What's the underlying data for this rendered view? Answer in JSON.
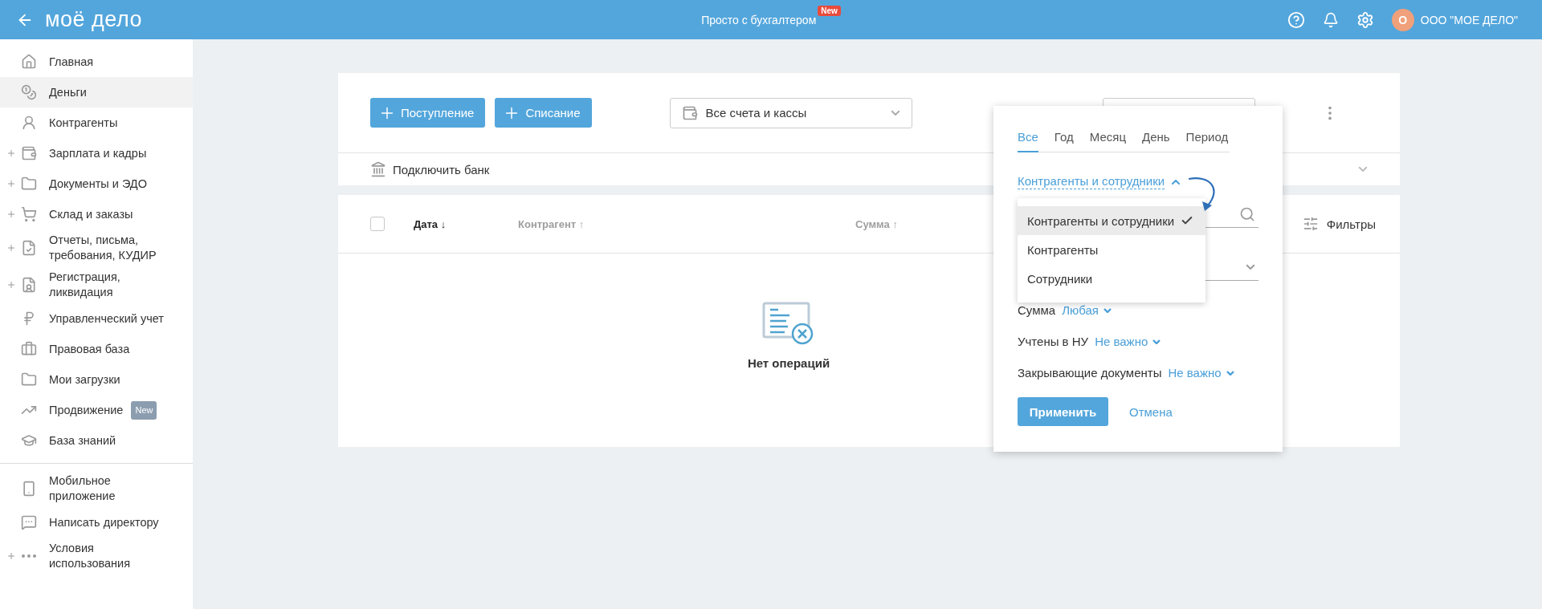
{
  "header": {
    "logo": "моё дело",
    "promo": "Просто с бухгалтером",
    "promo_badge": "New",
    "avatar_letter": "О",
    "company": "ООО \"МОЕ ДЕЛО\""
  },
  "sidebar": {
    "items": [
      {
        "label": "Главная",
        "selected": false,
        "expandable": false
      },
      {
        "label": "Деньги",
        "selected": true,
        "expandable": false
      },
      {
        "label": "Контрагенты",
        "selected": false,
        "expandable": false
      },
      {
        "label": "Зарплата и кадры",
        "selected": false,
        "expandable": true
      },
      {
        "label": "Документы и ЭДО",
        "selected": false,
        "expandable": true
      },
      {
        "label": "Склад и заказы",
        "selected": false,
        "expandable": true
      },
      {
        "label": "Отчеты, письма, требования, КУДИР",
        "selected": false,
        "expandable": true
      },
      {
        "label": "Регистрация, ликвидация",
        "selected": false,
        "expandable": true
      },
      {
        "label": "Управленческий учет",
        "selected": false,
        "expandable": false
      },
      {
        "label": "Правовая база",
        "selected": false,
        "expandable": false
      },
      {
        "label": "Мои загрузки",
        "selected": false,
        "expandable": false
      },
      {
        "label": "Продвижение",
        "selected": false,
        "expandable": false,
        "badge": "New"
      },
      {
        "label": "База знаний",
        "selected": false,
        "expandable": false
      }
    ],
    "bottom_items": [
      {
        "label": "Мобильное приложение",
        "selected": false,
        "expandable": false
      },
      {
        "label": "Написать директору",
        "selected": false,
        "expandable": false
      },
      {
        "label": "Условия использования",
        "selected": false,
        "expandable": true
      }
    ]
  },
  "toolbar": {
    "buttons": [
      "Поступление",
      "Списание"
    ],
    "account_select": "Все счета и кассы"
  },
  "bank": {
    "label": "Подключить банк"
  },
  "table": {
    "select_all": false,
    "columns": [
      {
        "label": "Дата",
        "arrow": "↓",
        "active": true
      },
      {
        "label": "Контрагент",
        "arrow": "↑",
        "active": false
      },
      {
        "label": "Сумма",
        "arrow": "↑",
        "active": false
      }
    ],
    "filters": "Фильтры",
    "empty": "Нет операций"
  },
  "filter_popup": {
    "tabs": [
      {
        "label": "Все",
        "selected": true
      },
      {
        "label": "Год",
        "selected": false
      },
      {
        "label": "Месяц",
        "selected": false
      },
      {
        "label": "День",
        "selected": false
      },
      {
        "label": "Период",
        "selected": false
      }
    ],
    "counterparty_link": "Контрагенты и сотрудники",
    "dropdown": [
      {
        "label": "Контрагенты и сотрудники",
        "selected": true
      },
      {
        "label": "Контрагенты",
        "selected": false
      },
      {
        "label": "Сотрудники",
        "selected": false
      }
    ],
    "rows": [
      {
        "label": "Сумма",
        "value": "Любая"
      },
      {
        "label": "Учтены в НУ",
        "value": "Не важно"
      },
      {
        "label": "Закрывающие документы",
        "value": "Не важно"
      }
    ],
    "apply": "Применить",
    "cancel": "Отмена"
  }
}
